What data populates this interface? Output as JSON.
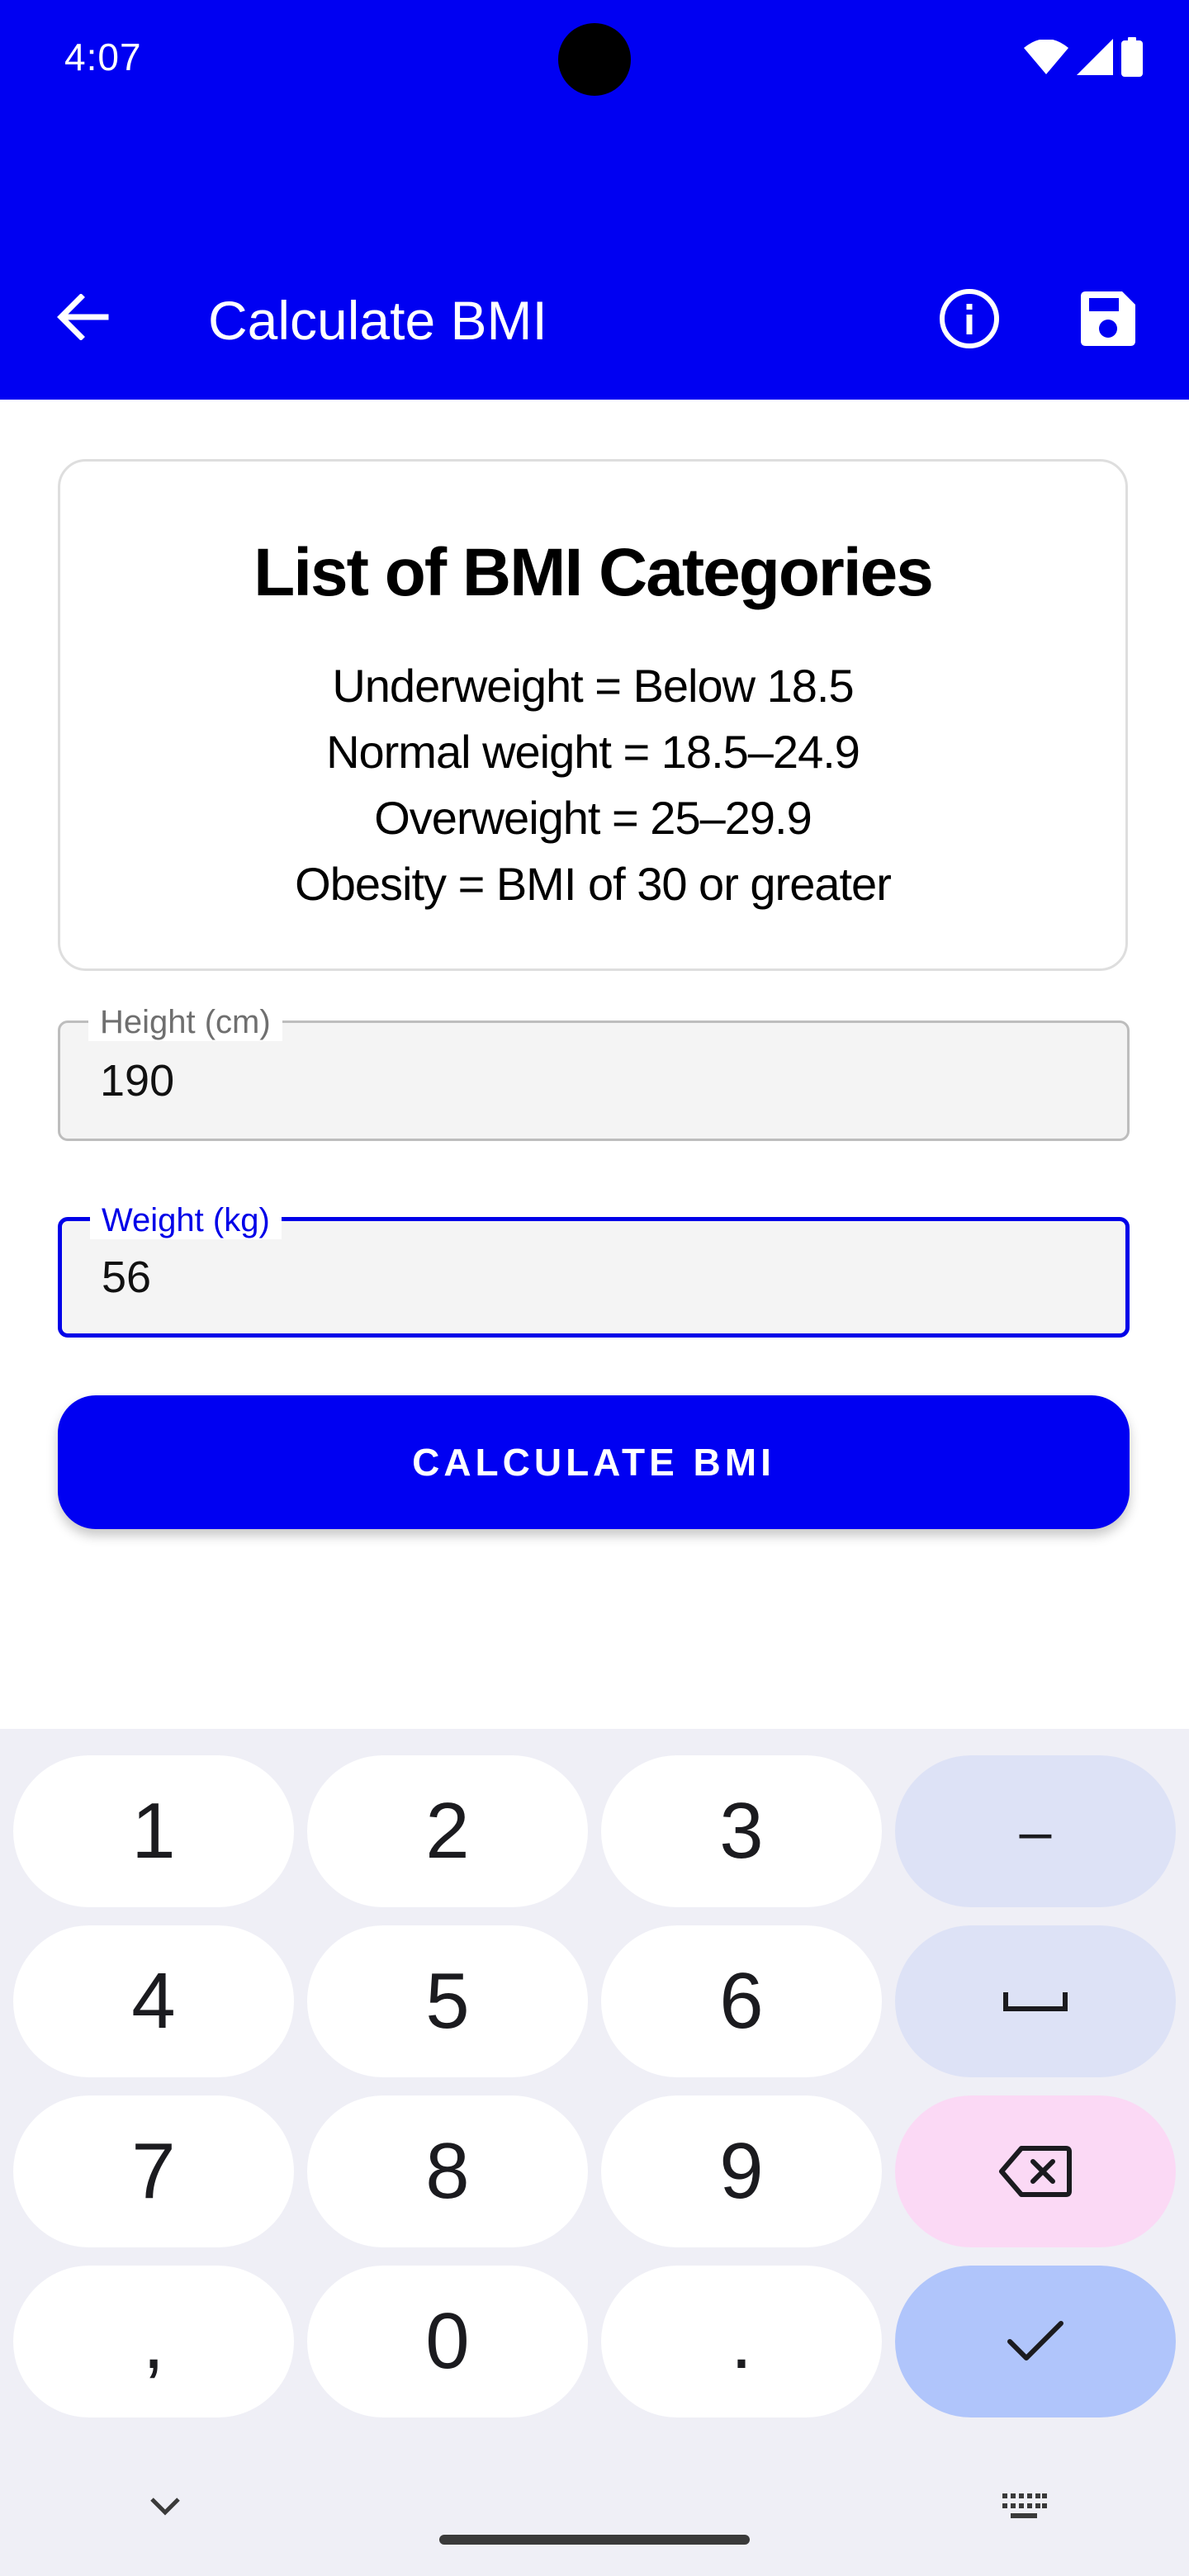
{
  "status_bar": {
    "time": "4:07",
    "icons": [
      "wifi-icon",
      "signal-icon",
      "battery-icon"
    ]
  },
  "app_bar": {
    "title": "Calculate BMI",
    "icons": [
      "back-arrow-icon",
      "info-icon",
      "save-icon"
    ]
  },
  "categories_card": {
    "title": "List of BMI Categories",
    "lines": [
      "Underweight = Below 18.5",
      "Normal weight = 18.5–24.9",
      "Overweight = 25–29.9",
      "Obesity = BMI of 30 or greater"
    ]
  },
  "height_field": {
    "label": "Height (cm)",
    "value": "190"
  },
  "weight_field": {
    "label": "Weight (kg)",
    "value": "56"
  },
  "calculate_button": {
    "label": "CALCULATE BMI"
  },
  "keyboard": {
    "rows": [
      [
        "1",
        "2",
        "3",
        "–"
      ],
      [
        "4",
        "5",
        "6",
        "space"
      ],
      [
        "7",
        "8",
        "9",
        "delete"
      ],
      [
        ",",
        "0",
        ".",
        "enter"
      ]
    ],
    "keys": {
      "k1": "1",
      "k2": "2",
      "k3": "3",
      "minus": "–",
      "k4": "4",
      "k5": "5",
      "k6": "6",
      "k7": "7",
      "k8": "8",
      "k9": "9",
      "comma": ",",
      "k0": "0",
      "period": "."
    }
  },
  "colors": {
    "primary": "#0000f2",
    "focused_field": "#0000e8",
    "keyboard_background": "#efeff6",
    "function_key": "#dde2f6",
    "delete_key": "#fbd9f5",
    "enter_key": "#b0c5fb"
  }
}
